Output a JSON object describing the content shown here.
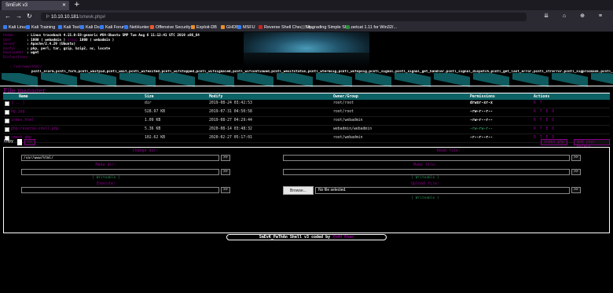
{
  "browser": {
    "tab_title": "SmEvK v3",
    "url_host": "10.10.10.181",
    "url_path": "/smevk.php#",
    "bookmarks": [
      "Kali Linux",
      "Kali Training",
      "Kali Tools",
      "Kali Docs",
      "Kali Forums",
      "NetHunter",
      "Offensive Security",
      "Exploit-DB",
      "GHDB",
      "MSFU",
      "Reverse Shell Cheat Sh...",
      "Upgrading Simple She...",
      "netcat 1.11 for Win32/..."
    ]
  },
  "info": {
    "uname_label": "Uname",
    "uname_value": ": Linux traceback 4.15.0-58-generic #64-Ubuntu SMP Tue Aug 6 11:12:41 UTC 2019 x86_64",
    "user_label": "User",
    "user_value": ": 1000 ( webadmin )",
    "group_label": "Group",
    "group_value": "1000 ( webadmin )",
    "server_label": "Server",
    "server_value": ": Apache/2.4.29 (Ubuntu)",
    "useful_label": "Useful",
    "useful_value": ": php, perl, tar, gzip, bzip2, nc, locate",
    "downloader_label": "Downloader",
    "downloader_value": ": wget",
    "disabled_label": "Disfunctions",
    "disabled_value": "pcntl_alarm,pcntl_fork,pcntl_waitpid,pcntl_wait,pcntl_wifexited,pcntl_wifstopped,pcntl_wifsignaled,pcntl_wifcontinued,pcntl_wexitstatus,pcntl_wtermsig,pcntl_wstopsig,pcntl_signal,pcntl_signal_get_handler,pcntl_signal_dispatch,pcntl_get_last_error,pcntl_strerror,pcntl_sigprocmask,pcntl_si",
    "path_value": ": /var/www/html/",
    "path_extra": "drwxr-xr-x [ Home ]"
  },
  "file_manager": {
    "title": "File manager",
    "headers": [
      "Name",
      "Size",
      "Modify",
      "Owner/Group",
      "Permissions",
      "Actions"
    ],
    "rows": [
      {
        "name": "[ .. ]",
        "size": "dir",
        "modify": "2019-08-24 03:42:53",
        "owner": "root/root",
        "perm": "drwxr-xr-x",
        "perm_color": "w",
        "actions": "R T"
      },
      {
        "name": "bg.jpg",
        "size": "528.97 KB",
        "modify": "2019-07-31 04:50:58",
        "owner": "root/root",
        "perm": "-rw-r--r--",
        "perm_color": "w",
        "actions": "R T E D"
      },
      {
        "name": "index.html",
        "size": "1.09 KB",
        "modify": "2019-08-27 04:29:44",
        "owner": "root/webadmin",
        "perm": "-rw-r--r--",
        "perm_color": "w",
        "actions": "R T E D"
      },
      {
        "name": "php-reverse-shell.php",
        "size": "5.36 KB",
        "modify": "2020-08-14 03:48:32",
        "owner": "webadmin/webadmin",
        "perm": "-rw-rw-r--",
        "perm_color": "g",
        "actions": "R T E D"
      },
      {
        "name": "smevk.php",
        "size": "102.62 KB",
        "modify": "2020-02-27 05:17:01",
        "owner": "root/webadmin",
        "perm": "-r--r--r--",
        "perm_color": "w",
        "actions": "R T E D"
      }
    ],
    "copy_label": "Copy",
    "go_label": ">>",
    "deface_file": "index.php",
    "deface_button": "Add your Deface"
  },
  "tools": {
    "change_dir_label": "Change dir:",
    "change_dir_value": "/var/www/html/",
    "read_file_label": "Read file:",
    "make_dir_label": "Make dir:",
    "make_file_label": "Make file:",
    "writable": "[ Writeable ]",
    "execute_label": "Execute:",
    "upload_label": "Upload file:",
    "browse_label": "Browse...",
    "no_file": "No file selected.",
    "go": ">>"
  },
  "footer": {
    "text": "SmEvK_PaThAn Shell v3 coded by",
    "author": "Xh4H Khan"
  },
  "colors": {
    "accent": "#8b008b",
    "header_teal": "#0d6265",
    "writable_green": "#2e8b57"
  }
}
